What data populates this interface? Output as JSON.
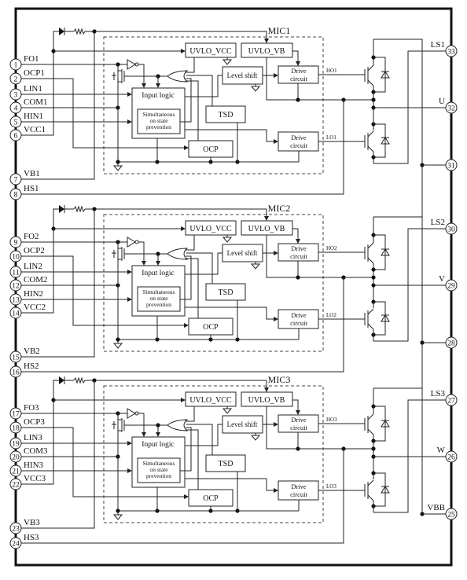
{
  "blocks": [
    {
      "mic": "MIC1",
      "ho": "HO1",
      "lo": "LO1",
      "pins_left": [
        {
          "num": "1",
          "label": "FO1"
        },
        {
          "num": "2",
          "label": "OCP1"
        },
        {
          "num": "3",
          "label": "LIN1"
        },
        {
          "num": "4",
          "label": "COM1"
        },
        {
          "num": "5",
          "label": "HIN1"
        },
        {
          "num": "6",
          "label": "VCC1"
        },
        {
          "num": "7",
          "label": "VB1"
        },
        {
          "num": "8",
          "label": "HS1"
        }
      ],
      "pins_right": [
        {
          "num": "33",
          "label": "LS1"
        },
        {
          "num": "32",
          "label": "U"
        },
        {
          "num": "31",
          "label": ""
        }
      ]
    },
    {
      "mic": "MIC2",
      "ho": "HO2",
      "lo": "LO2",
      "pins_left": [
        {
          "num": "9",
          "label": "FO2"
        },
        {
          "num": "10",
          "label": "OCP2"
        },
        {
          "num": "11",
          "label": "LIN2"
        },
        {
          "num": "12",
          "label": "COM2"
        },
        {
          "num": "13",
          "label": "HIN2"
        },
        {
          "num": "14",
          "label": "VCC2"
        },
        {
          "num": "15",
          "label": "VB2"
        },
        {
          "num": "16",
          "label": "HS2"
        }
      ],
      "pins_right": [
        {
          "num": "30",
          "label": "LS2"
        },
        {
          "num": "29",
          "label": "V"
        },
        {
          "num": "28",
          "label": ""
        }
      ]
    },
    {
      "mic": "MIC3",
      "ho": "HO3",
      "lo": "LO3",
      "pins_left": [
        {
          "num": "17",
          "label": "FO3"
        },
        {
          "num": "18",
          "label": "OCP3"
        },
        {
          "num": "19",
          "label": "LIN3"
        },
        {
          "num": "20",
          "label": "COM3"
        },
        {
          "num": "21",
          "label": "HIN3"
        },
        {
          "num": "22",
          "label": "VCC3"
        },
        {
          "num": "23",
          "label": "VB3"
        },
        {
          "num": "24",
          "label": "HS3"
        }
      ],
      "pins_right": [
        {
          "num": "27",
          "label": "LS3"
        },
        {
          "num": "26",
          "label": "W"
        },
        {
          "num": "25",
          "label": "VBB"
        }
      ]
    }
  ],
  "labels": {
    "uvlo_vcc": "UVLO_VCC",
    "uvlo_vb": "UVLO_VB",
    "level_shift": "Level shift",
    "drive": [
      "Drive",
      "circuit"
    ],
    "input_logic": "Input logic",
    "sim": [
      "Simultaneous",
      "on state",
      "prevention"
    ],
    "tsd": "TSD",
    "ocp": "OCP"
  }
}
